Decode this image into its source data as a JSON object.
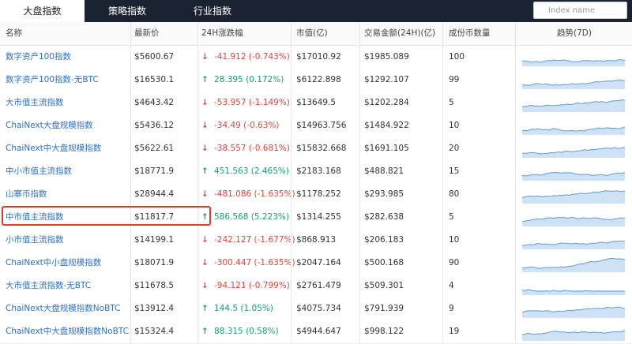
{
  "tabs": [
    {
      "label": "大盘指数",
      "active": true
    },
    {
      "label": "策略指数",
      "active": false
    },
    {
      "label": "行业指数",
      "active": false
    }
  ],
  "search": {
    "placeholder": "Index name"
  },
  "columns": {
    "name": "名称",
    "price": "最新价",
    "change": "24H涨跌幅",
    "market_cap": "市值(亿)",
    "volume": "交易金额(24H)(亿)",
    "constituents": "成份币数量",
    "trend": "趋势(7D)"
  },
  "rows": [
    {
      "name": "数字资产100指数",
      "price": "$5600.67",
      "change": "-41.912 (-0.743%)",
      "dir": "down",
      "market_cap": "$17010.92",
      "volume": "$1985.089",
      "constituents": "100"
    },
    {
      "name": "数字资产100指数-无BTC",
      "price": "$16530.1",
      "change": "28.395 (0.172%)",
      "dir": "up",
      "market_cap": "$6122.898",
      "volume": "$1292.107",
      "constituents": "99"
    },
    {
      "name": "大市值主流指数",
      "price": "$4643.42",
      "change": "-53.957 (-1.149%)",
      "dir": "down",
      "market_cap": "$13649.5",
      "volume": "$1202.284",
      "constituents": "5"
    },
    {
      "name": "ChaiNext大盘规模指数",
      "price": "$5436.12",
      "change": "-34.49 (-0.63%)",
      "dir": "down",
      "market_cap": "$14963.756",
      "volume": "$1484.922",
      "constituents": "10"
    },
    {
      "name": "ChaiNext中大盘规模指数",
      "price": "$5622.61",
      "change": "-38.557 (-0.681%)",
      "dir": "down",
      "market_cap": "$15832.668",
      "volume": "$1691.105",
      "constituents": "20"
    },
    {
      "name": "中小市值主流指数",
      "price": "$18771.9",
      "change": "451.563 (2.465%)",
      "dir": "up",
      "market_cap": "$2183.168",
      "volume": "$488.821",
      "constituents": "15"
    },
    {
      "name": "山寨币指数",
      "price": "$28944.4",
      "change": "-481.086 (-1.635%)",
      "dir": "down",
      "market_cap": "$1178.252",
      "volume": "$293.985",
      "constituents": "80"
    },
    {
      "name": "中市值主流指数",
      "price": "$11817.7",
      "change": "586.568 (5.223%)",
      "dir": "up",
      "market_cap": "$1314.255",
      "volume": "$282.638",
      "constituents": "5",
      "highlighted": true
    },
    {
      "name": "小市值主流指数",
      "price": "$14199.1",
      "change": "-242.127 (-1.677%)",
      "dir": "down",
      "market_cap": "$868.913",
      "volume": "$206.183",
      "constituents": "10"
    },
    {
      "name": "ChaiNext中小盘规模指数",
      "price": "$18071.9",
      "change": "-300.447 (-1.635%)",
      "dir": "down",
      "market_cap": "$2047.164",
      "volume": "$500.168",
      "constituents": "90"
    },
    {
      "name": "大市值主流指数-无BTC",
      "price": "$11678.5",
      "change": "-94.121 (-0.799%)",
      "dir": "down",
      "market_cap": "$2761.479",
      "volume": "$509.301",
      "constituents": "4"
    },
    {
      "name": "ChaiNext大盘规模指数NoBTC",
      "price": "$13912.4",
      "change": "144.5 (1.05%)",
      "dir": "up",
      "market_cap": "$4075.734",
      "volume": "$791.939",
      "constituents": "9"
    },
    {
      "name": "ChaiNext中大盘规模指数NoBTC",
      "price": "$15324.4",
      "change": "88.315 (0.58%)",
      "dir": "up",
      "market_cap": "$4944.647",
      "volume": "$998.122",
      "constituents": "19"
    }
  ],
  "icons": {
    "down": "arrow-down-icon",
    "up": "arrow-up-icon"
  },
  "colors": {
    "nav_bg": "#1b2232",
    "link": "#2c6fc6",
    "down": "#e2443a",
    "up": "#14a06d",
    "spark": "#5b9bd5",
    "highlight": "#e03a2e"
  }
}
